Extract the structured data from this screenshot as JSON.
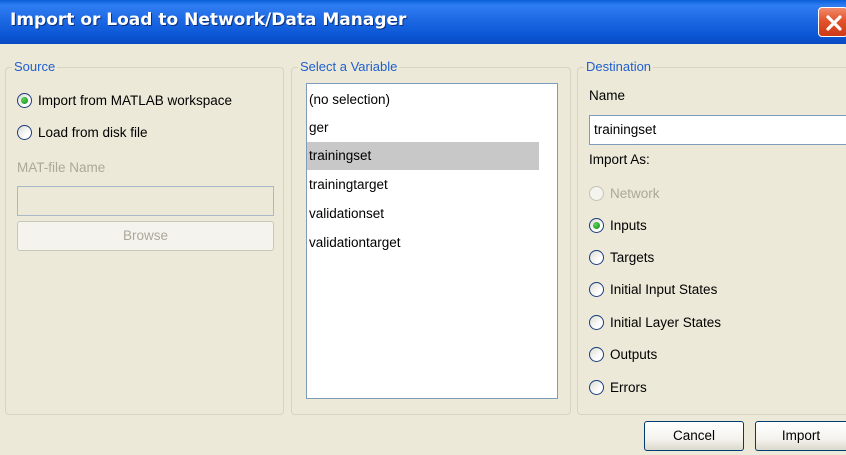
{
  "window": {
    "title": "Import or Load to Network/Data Manager"
  },
  "source": {
    "group_title": "Source",
    "options": [
      {
        "label": "Import from MATLAB workspace",
        "checked": true
      },
      {
        "label": "Load from disk file",
        "checked": false
      }
    ],
    "mat_file_label": "MAT-file Name",
    "mat_file_value": "",
    "browse_label": "Browse"
  },
  "variables": {
    "group_title": "Select a Variable",
    "items": [
      "(no selection)",
      "ger",
      "trainingset",
      "trainingtarget",
      "validationset",
      "validationtarget"
    ],
    "selected": "trainingset"
  },
  "destination": {
    "group_title": "Destination",
    "name_label": "Name",
    "name_value": "trainingset",
    "import_as_label": "Import As:",
    "options": [
      {
        "label": "Network",
        "checked": false,
        "enabled": false
      },
      {
        "label": "Inputs",
        "checked": true,
        "enabled": true
      },
      {
        "label": "Targets",
        "checked": false,
        "enabled": true
      },
      {
        "label": "Initial Input States",
        "checked": false,
        "enabled": true
      },
      {
        "label": "Initial Layer States",
        "checked": false,
        "enabled": true
      },
      {
        "label": "Outputs",
        "checked": false,
        "enabled": true
      },
      {
        "label": "Errors",
        "checked": false,
        "enabled": true
      }
    ]
  },
  "buttons": {
    "cancel_label": "Cancel",
    "import_label": "Import"
  },
  "colors": {
    "title_bar": "#0b56d4",
    "group_title": "#1f5fcf",
    "selection": "#c8c8c8",
    "radio_checked": "#21a121"
  },
  "icons": {
    "close": "close-x-icon",
    "radio": "radio-button"
  }
}
